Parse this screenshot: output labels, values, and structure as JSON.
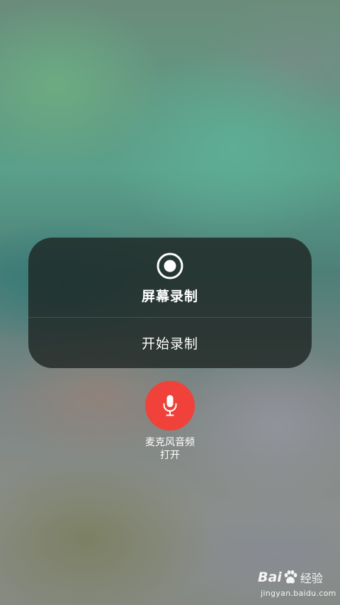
{
  "screen_recording": {
    "title": "屏幕录制",
    "start_label": "开始录制",
    "icon": "record-icon"
  },
  "microphone": {
    "label": "麦克风音频",
    "status": "打开",
    "icon": "microphone-icon",
    "color": "#f0413a"
  },
  "watermark": {
    "brand": "Bai",
    "brand_suffix": "经验",
    "url": "jingyan.baidu.com"
  },
  "colors": {
    "panel_background": "#1c2220",
    "text": "#ffffff"
  }
}
